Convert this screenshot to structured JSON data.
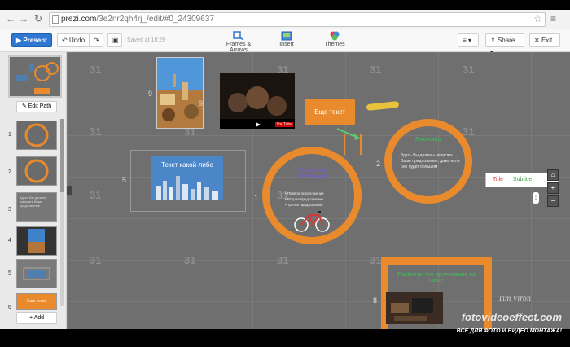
{
  "browser": {
    "url_domain": "prezi.com",
    "url_path": "/3e2nr2qh4rj_/edit/#0_24309637"
  },
  "toolbar": {
    "present_label": "Present",
    "undo_label": "Undo",
    "saved_text": "Saved at 18:29",
    "tools": [
      {
        "label": "Frames & Arrows",
        "icon": "frames-arrows-icon"
      },
      {
        "label": "Insert",
        "icon": "insert-icon"
      },
      {
        "label": "Themes",
        "icon": "themes-icon"
      }
    ],
    "share_label": "Share",
    "exit_label": "Exit"
  },
  "leftpanel": {
    "edit_path_label": "Edit Path",
    "add_label": "Add",
    "thumb_numbers": [
      "1",
      "2",
      "3",
      "4",
      "5",
      "6"
    ],
    "thumb_texts": {
      "t3": "Здесь Вы должны написать Ваше предложение",
      "t6": "Еще текст"
    }
  },
  "canvas": {
    "grid_number": "31",
    "frame_numbers": {
      "f1": "1",
      "f2": "2",
      "f5": "5",
      "f8": "8",
      "f9": "9"
    },
    "text_box": "Текст какой-либо",
    "orange_box": "Еще текст",
    "ring1_title": "Мои новые презентации",
    "ring1_bullets": [
      "• Первое предложение",
      "• Второе предложение",
      "• Третье предложение"
    ],
    "ring2_title": "Заголовок",
    "ring2_body": "Здесь Вы должны написать Ваше предложение, даже если оно будет большим",
    "bottom_title": "Посмотри это приложение на сайте",
    "style_title": "Title",
    "style_subtitle": "Subtitle",
    "youtube_label": "YouTube"
  },
  "watermark": {
    "brand": "fotovideoeffect.com",
    "tagline": "ВСЕ ДЛЯ ФОТО И ВИДЕО МОНТАЖА!",
    "signature": "Tim Viron"
  },
  "colors": {
    "accent_orange": "#e98a2c",
    "present_blue": "#2f77d1",
    "canvas_gray": "#6f6f6f"
  }
}
